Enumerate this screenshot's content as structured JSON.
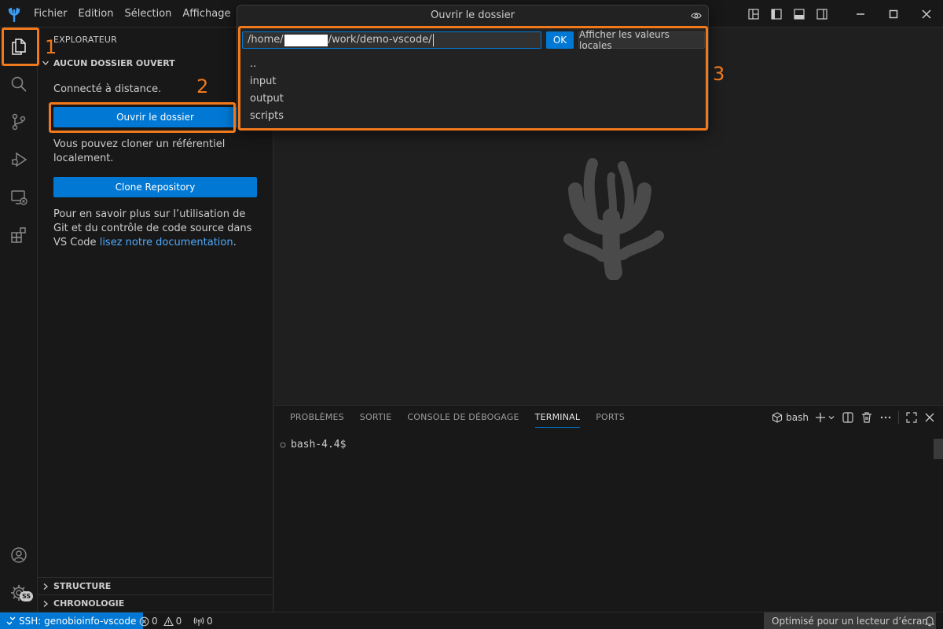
{
  "menu": [
    "Fichier",
    "Edition",
    "Sélection",
    "Affichage"
  ],
  "sidebar": {
    "title": "EXPLORATEUR",
    "section_open": "AUCUN DOSSIER OUVERT",
    "connected": "Connecté à distance.",
    "open_folder_button": "Ouvrir le dossier",
    "clone_text": "Vous pouvez cloner un référentiel localement.",
    "clone_button": "Clone Repository",
    "docs_text": "Pour en savoir plus sur l’utilisation de Git et du contrôle de code source dans VS Code",
    "docs_link": "lisez notre documentation",
    "docs_end": ".",
    "bottom_sections": [
      "STRUCTURE",
      "CHRONOLOGIE"
    ]
  },
  "quickpick": {
    "title": "Ouvrir le dossier",
    "path_prefix": "/home/",
    "path_suffix": "/work/demo-vscode/",
    "ok_label": "OK",
    "local_button": "Afficher les valeurs locales",
    "items": [
      "..",
      "input",
      "output",
      "scripts"
    ]
  },
  "panel": {
    "tabs": [
      "PROBLÈMES",
      "SORTIE",
      "CONSOLE DE DÉBOGAGE",
      "TERMINAL",
      "PORTS"
    ],
    "active_tab": "TERMINAL",
    "shell_label": "bash",
    "prompt": "bash-4.4$"
  },
  "activity": {
    "account_badge": "SS"
  },
  "statusbar": {
    "remote": "SSH: genobioinfo-vscode",
    "errors": "0",
    "warnings": "0",
    "ports": "0",
    "screen_reader": "Optimisé pour un lecteur d’écran"
  },
  "annotations": [
    "1",
    "2",
    "3"
  ],
  "colors": {
    "accent": "#0078d4",
    "annotation": "#f0791c",
    "link": "#4daafc"
  }
}
